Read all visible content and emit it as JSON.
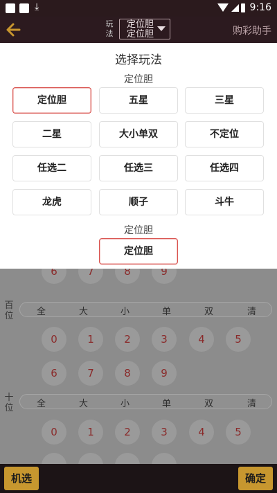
{
  "status_bar": {
    "download_glyph": "⤓",
    "time": "9:16"
  },
  "header": {
    "play_label": "玩法",
    "selected_line1": "定位胆",
    "selected_line2": "定位胆",
    "helper": "购彩助手"
  },
  "panel": {
    "title": "选择玩法",
    "section1_label": "定位胆",
    "options": [
      "定位胆",
      "五星",
      "三星",
      "二星",
      "大小单双",
      "不定位",
      "任选二",
      "任选三",
      "任选四",
      "龙虎",
      "顺子",
      "斗牛"
    ],
    "selected_option": "定位胆",
    "section2_label": "定位胆",
    "sub_option": "定位胆"
  },
  "board": {
    "partial_top": [
      "6",
      "7",
      "8",
      "9"
    ],
    "rows": [
      {
        "label": "百位",
        "filters": [
          "全",
          "大",
          "小",
          "单",
          "双",
          "清"
        ],
        "digits_row1": [
          "0",
          "1",
          "2",
          "3",
          "4",
          "5"
        ],
        "digits_row2": [
          "6",
          "7",
          "8",
          "9"
        ]
      },
      {
        "label": "十位",
        "filters": [
          "全",
          "大",
          "小",
          "单",
          "双",
          "清"
        ],
        "digits_row1": [
          "0",
          "1",
          "2",
          "3",
          "4",
          "5"
        ]
      }
    ]
  },
  "footer": {
    "random_label": "机选",
    "confirm_label": "确定"
  },
  "colors": {
    "accent": "#d9534f",
    "header_bg": "#2c1a1f",
    "button_gold": "#c7972f",
    "digit": "#8a2a2a"
  }
}
